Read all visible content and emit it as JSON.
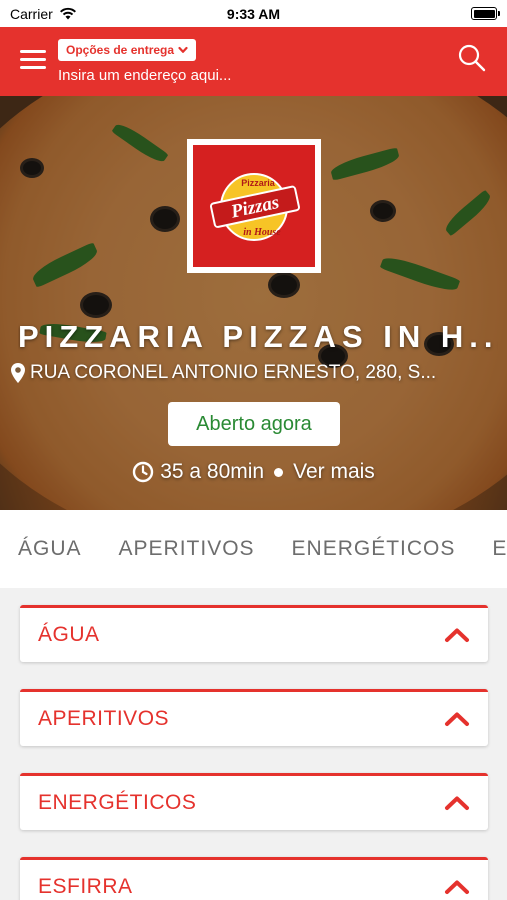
{
  "status_bar": {
    "carrier": "Carrier",
    "time": "9:33 AM"
  },
  "header": {
    "delivery_options_label": "Opções de entrega",
    "address_placeholder": "Insira um endereço aqui..."
  },
  "store": {
    "logo_text_top": "Pizzaria",
    "logo_text_main": "Pizzas",
    "logo_text_sub": "in House",
    "name": "PIZZARIA PIZZAS IN H...",
    "address": "RUA CORONEL ANTONIO ERNESTO, 280, S...",
    "status": "Aberto agora",
    "delivery_time": "35 a 80min",
    "see_more": "Ver mais"
  },
  "category_tabs": [
    {
      "label": "ÁGUA"
    },
    {
      "label": "APERITIVOS"
    },
    {
      "label": "ENERGÉTICOS"
    },
    {
      "label": "ES"
    }
  ],
  "sections": [
    {
      "title": "ÁGUA"
    },
    {
      "title": "APERITIVOS"
    },
    {
      "title": "ENERGÉTICOS"
    },
    {
      "title": "ESFIRRA"
    }
  ],
  "colors": {
    "brand": "#e5322d",
    "open_status": "#2a8a34"
  }
}
